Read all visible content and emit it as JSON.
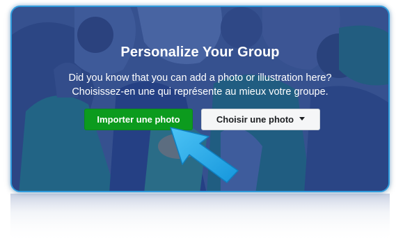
{
  "banner": {
    "title": "Personalize Your Group",
    "line1": "Did you know that you can add a photo or illustration here?",
    "line2": "Choisissez-en une qui représente au mieux votre groupe.",
    "upload_label": "Importer une photo",
    "choose_label": "Choisir une photo",
    "caret_icon": "caret-down-icon"
  },
  "pointer": {
    "icon": "arrow-pointer-icon"
  },
  "colors": {
    "upload_green": "#0c9b1e",
    "card_blue": "#3b5a9a",
    "arrow_blue": "#1aa6e8"
  }
}
